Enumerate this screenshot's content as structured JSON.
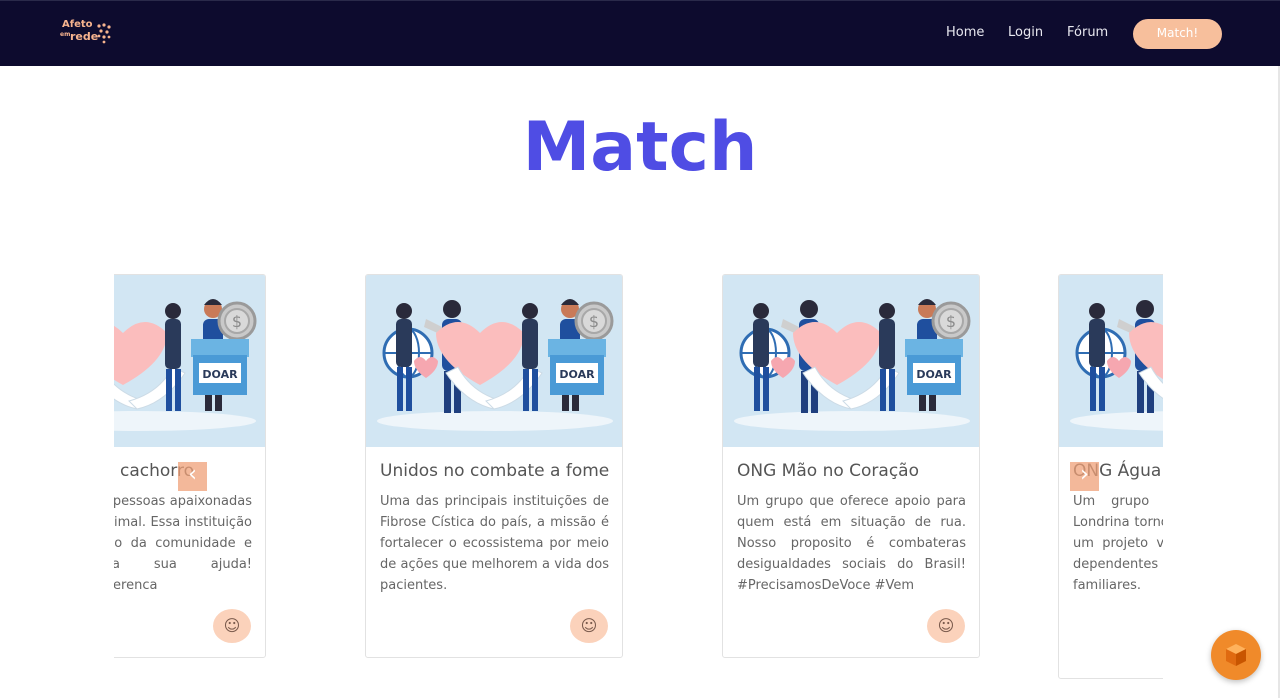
{
  "nav": {
    "logo_line1": "Afeto",
    "logo_line2": "em",
    "logo_line3": "rede",
    "home": "Home",
    "login": "Login",
    "forum": "Fórum",
    "match": "Match!"
  },
  "page": {
    "title": "Match"
  },
  "images": {
    "donate_label": "DOAR"
  },
  "cards": [
    {
      "title": "Unidos pra cachorro",
      "text": "Um grupo de pessoas apaixonadas pela causa animal. Essa instituição está a serviço da comunidade e precisa da sua ajuda! #VoceFazADiferenca",
      "action": "☺"
    },
    {
      "title": "Unidos no combate a fome",
      "text": "Uma das principais instituições de Fibrose Cística do país, a missão é fortalecer o ecossistema por meio de ações que melhorem a vida dos pacientes.",
      "action": "☺"
    },
    {
      "title": "ONG Mão no Coração",
      "text": "Um grupo que oferece apoio para quem está em situação de rua. Nosso proposito é combateras desigualdades sociais do Brasil! #PrecisamosDeVoce #Vem",
      "action": "☺"
    },
    {
      "title": "ONG Água Viva",
      "text": "Um grupo de voluntários de Londrina tornou possível implantar um projeto voltado para atender dependentes químicos e seus familiares.",
      "action": "☺"
    }
  ],
  "carousel": {
    "prev": "‹",
    "next": "›"
  },
  "colors": {
    "navbar": "#0d0b2e",
    "accent": "#4f4de4",
    "peach": "#f7bf9c"
  }
}
